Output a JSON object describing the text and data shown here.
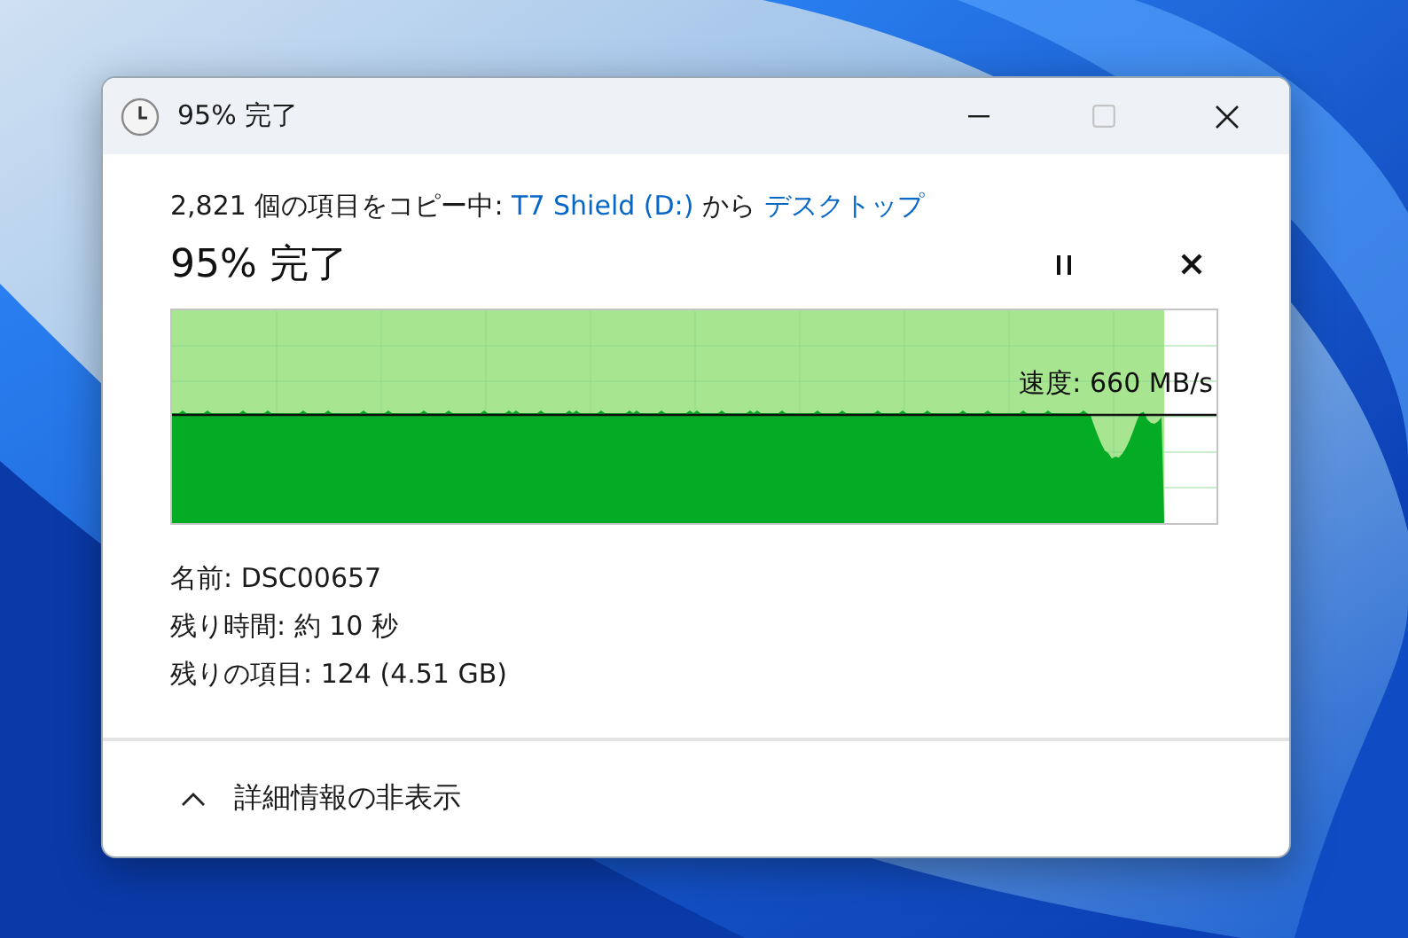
{
  "window": {
    "title": "95% 完了",
    "title_buttons": [
      {
        "kind": "minimize",
        "disabled": false
      },
      {
        "kind": "maximize",
        "disabled": true
      },
      {
        "kind": "close",
        "disabled": false
      }
    ]
  },
  "copy_status": {
    "prefix": "2,821 個の項目をコピー中: ",
    "source": "T7 Shield (D:)",
    "middle": " から ",
    "destination": "デスクトップ"
  },
  "progress": {
    "heading": "95% 完了",
    "level": 0.95,
    "speed": "速度: 660 MB/s",
    "paused": false
  },
  "details": [
    "名前: DSC00657",
    "残り時間: 約 10 秒",
    "残りの項目: 124 (4.51 GB)"
  ],
  "toggle": {
    "label": "詳細情報の非表示",
    "expanded": true
  }
}
